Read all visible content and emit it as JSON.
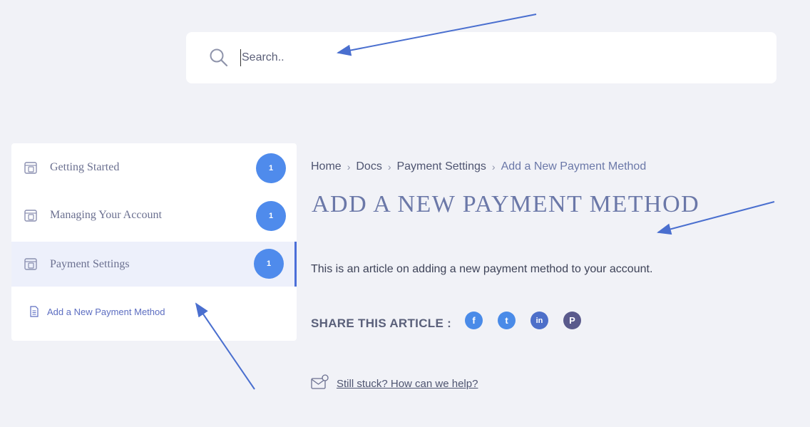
{
  "search": {
    "placeholder": "Search.."
  },
  "sidebar": {
    "categories": [
      {
        "label": "Getting Started",
        "count": "1"
      },
      {
        "label": "Managing Your Account",
        "count": "1"
      },
      {
        "label": "Payment Settings",
        "count": "1",
        "active": true
      }
    ],
    "sub_item": {
      "label": "Add a New Payment Method"
    }
  },
  "breadcrumb": {
    "items": [
      "Home",
      "Docs",
      "Payment Settings",
      "Add a New Payment Method"
    ]
  },
  "article": {
    "title": "ADD A NEW PAYMENT METHOD",
    "body": "This is an article on adding a new payment method to your account."
  },
  "share": {
    "label": "SHARE THIS ARTICLE :",
    "icons": [
      {
        "name": "facebook-icon",
        "glyph": "f",
        "color": "#4a8be8"
      },
      {
        "name": "twitter-icon",
        "glyph": "t",
        "color": "#4a8be8"
      },
      {
        "name": "linkedin-icon",
        "glyph": "in",
        "color": "#4d6fc9"
      },
      {
        "name": "pinterest-icon",
        "glyph": "P",
        "color": "#5a5a8c"
      }
    ]
  },
  "help": {
    "link_text": "Still stuck? How can we help?"
  },
  "colors": {
    "accent": "#4f8bec",
    "arrow": "#4a6fcf",
    "background": "#f1f2f7"
  }
}
